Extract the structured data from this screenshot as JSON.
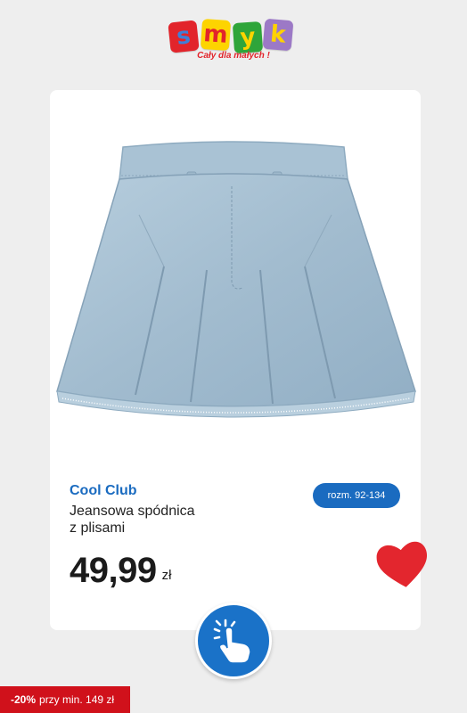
{
  "logo": {
    "letters": [
      "s",
      "m",
      "y",
      "k"
    ],
    "tagline": "Cały dla małych !",
    "colors": [
      "#e2242b",
      "#fdd400",
      "#2fa53a",
      "#9c79c6"
    ]
  },
  "product": {
    "image": "denim-pleated-skirt",
    "brand": "Cool Club",
    "name_line1": "Jeansowa spódnica",
    "name_line2": "z plisami",
    "size_badge": "rozm. 92-134",
    "price": "49,99",
    "currency": "zł"
  },
  "actions": {
    "favorite_icon": "heart-icon",
    "tap_icon": "hand-tap-icon"
  },
  "promo": {
    "discount": "-20%",
    "condition": "przy min. 149 zł"
  },
  "colors": {
    "accent_blue": "#1a6bc0",
    "promo_red": "#d0111b",
    "heart_red": "#e3262e"
  }
}
